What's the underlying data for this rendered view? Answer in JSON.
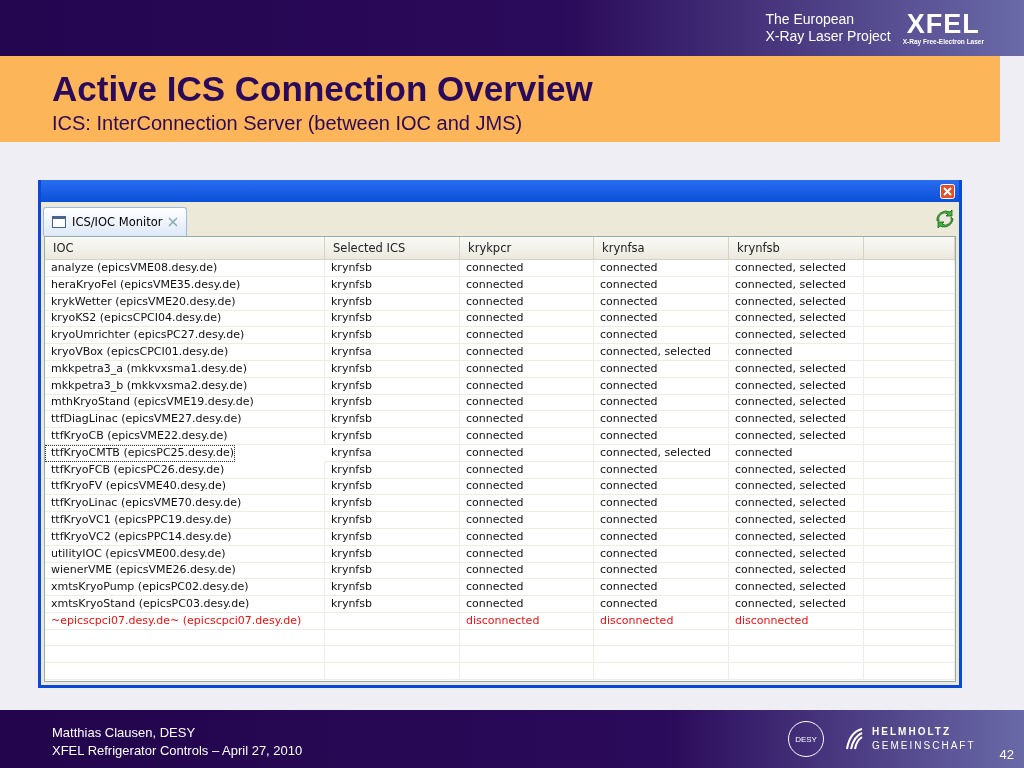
{
  "header": {
    "org_line_1": "The European",
    "org_line_2": "X-Ray Laser Project",
    "logo_text": "XFEL",
    "logo_subtitle": "X-Ray Free-Electron Laser"
  },
  "title": "Active ICS Connection Overview",
  "subtitle": "ICS: InterConnection Server (between IOC and JMS)",
  "window": {
    "tab": {
      "label": "ICS/IOC Monitor",
      "selected": true
    },
    "table": {
      "columns": [
        "IOC",
        "Selected ICS",
        "krykpcr",
        "krynfsa",
        "krynfsb"
      ],
      "rows": [
        {
          "kind": "ok",
          "focused": false,
          "cells": [
            "analyze (epicsVME08.desy.de)",
            "krynfsb",
            "connected",
            "connected",
            "connected, selected"
          ]
        },
        {
          "kind": "ok",
          "focused": false,
          "cells": [
            "heraKryoFel (epicsVME35.desy.de)",
            "krynfsb",
            "connected",
            "connected",
            "connected, selected"
          ]
        },
        {
          "kind": "ok",
          "focused": false,
          "cells": [
            "krykWetter (epicsVME20.desy.de)",
            "krynfsb",
            "connected",
            "connected",
            "connected, selected"
          ]
        },
        {
          "kind": "ok",
          "focused": false,
          "cells": [
            "kryoKS2 (epicsCPCI04.desy.de)",
            "krynfsb",
            "connected",
            "connected",
            "connected, selected"
          ]
        },
        {
          "kind": "ok",
          "focused": false,
          "cells": [
            "kryoUmrichter (epicsPC27.desy.de)",
            "krynfsb",
            "connected",
            "connected",
            "connected, selected"
          ]
        },
        {
          "kind": "ok",
          "focused": false,
          "cells": [
            "kryoVBox (epicsCPCI01.desy.de)",
            "krynfsa",
            "connected",
            "connected, selected",
            "connected"
          ]
        },
        {
          "kind": "ok",
          "focused": false,
          "cells": [
            "mkkpetra3_a (mkkvxsma1.desy.de)",
            "krynfsb",
            "connected",
            "connected",
            "connected, selected"
          ]
        },
        {
          "kind": "ok",
          "focused": false,
          "cells": [
            "mkkpetra3_b (mkkvxsma2.desy.de)",
            "krynfsb",
            "connected",
            "connected",
            "connected, selected"
          ]
        },
        {
          "kind": "ok",
          "focused": false,
          "cells": [
            "mthKryoStand (epicsVME19.desy.de)",
            "krynfsb",
            "connected",
            "connected",
            "connected, selected"
          ]
        },
        {
          "kind": "ok",
          "focused": false,
          "cells": [
            "ttfDiagLinac (epicsVME27.desy.de)",
            "krynfsb",
            "connected",
            "connected",
            "connected, selected"
          ]
        },
        {
          "kind": "ok",
          "focused": false,
          "cells": [
            "ttfKryoCB (epicsVME22.desy.de)",
            "krynfsb",
            "connected",
            "connected",
            "connected, selected"
          ]
        },
        {
          "kind": "ok",
          "focused": true,
          "cells": [
            "ttfKryoCMTB (epicsPC25.desy.de)",
            "krynfsa",
            "connected",
            "connected, selected",
            "connected"
          ]
        },
        {
          "kind": "ok",
          "focused": false,
          "cells": [
            "ttfKryoFCB (epicsPC26.desy.de)",
            "krynfsb",
            "connected",
            "connected",
            "connected, selected"
          ]
        },
        {
          "kind": "ok",
          "focused": false,
          "cells": [
            "ttfKryoFV (epicsVME40.desy.de)",
            "krynfsb",
            "connected",
            "connected",
            "connected, selected"
          ]
        },
        {
          "kind": "ok",
          "focused": false,
          "cells": [
            "ttfKryoLinac (epicsVME70.desy.de)",
            "krynfsb",
            "connected",
            "connected",
            "connected, selected"
          ]
        },
        {
          "kind": "ok",
          "focused": false,
          "cells": [
            "ttfKryoVC1 (epicsPPC19.desy.de)",
            "krynfsb",
            "connected",
            "connected",
            "connected, selected"
          ]
        },
        {
          "kind": "ok",
          "focused": false,
          "cells": [
            "ttfKryoVC2 (epicsPPC14.desy.de)",
            "krynfsb",
            "connected",
            "connected",
            "connected, selected"
          ]
        },
        {
          "kind": "ok",
          "focused": false,
          "cells": [
            "utilityIOC (epicsVME00.desy.de)",
            "krynfsb",
            "connected",
            "connected",
            "connected, selected"
          ]
        },
        {
          "kind": "ok",
          "focused": false,
          "cells": [
            "wienerVME (epicsVME26.desy.de)",
            "krynfsb",
            "connected",
            "connected",
            "connected, selected"
          ]
        },
        {
          "kind": "ok",
          "focused": false,
          "cells": [
            "xmtsKryoPump (epicsPC02.desy.de)",
            "krynfsb",
            "connected",
            "connected",
            "connected, selected"
          ]
        },
        {
          "kind": "ok",
          "focused": false,
          "cells": [
            "xmtsKryoStand (epicsPC03.desy.de)",
            "krynfsb",
            "connected",
            "connected",
            "connected, selected"
          ]
        },
        {
          "kind": "error",
          "focused": false,
          "cells": [
            "~epicscpci07.desy.de~ (epicscpci07.desy.de)",
            "",
            "disconnected",
            "disconnected",
            "disconnected"
          ]
        }
      ]
    }
  },
  "footer": {
    "author": "Matthias Clausen, DESY",
    "talk": "XFEL Refrigerator Controls – April 27, 2010",
    "desy_logo": "DESY",
    "helmholtz_1": "HELMHOLTZ",
    "helmholtz_2": "GEMEINSCHAFT",
    "page": "42"
  }
}
